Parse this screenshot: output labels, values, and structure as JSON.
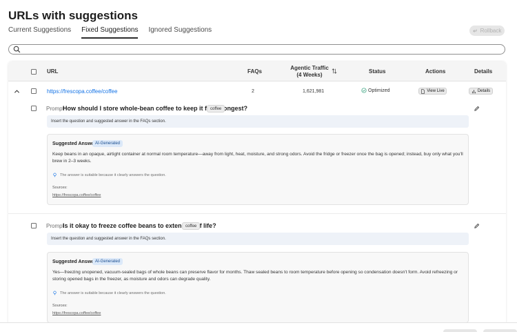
{
  "page": {
    "title": "URLs with suggestions"
  },
  "tabs": [
    {
      "label": "Current Suggestions"
    },
    {
      "label": "Fixed Suggestions"
    },
    {
      "label": "Ignored Suggestions"
    }
  ],
  "active_tab": "Fixed Suggestions",
  "rollback": {
    "label": "Rollback"
  },
  "search": {
    "placeholder": "",
    "value": ""
  },
  "table": {
    "headers": {
      "url": "URL",
      "faqs": "FAQs",
      "traffic": "Agentic Traffic (4 Weeks)",
      "status": "Status",
      "actions": "Actions",
      "details": "Details"
    },
    "rows": [
      {
        "url": "https://frescopa.coffee/coffee",
        "faqs": "2",
        "traffic": "1,621,981",
        "status": "Optimized",
        "view_live_label": "View Live",
        "details_label": "Details",
        "prompts": [
          {
            "prompt_label": "Prompt",
            "question": "How should I store whole-bean coffee to keep it fresh longest?",
            "tag": "coffee",
            "info": "Insert the question and suggested answer in the FAQs section.",
            "answer_title": "Suggested Answer",
            "ai_badge": "AI-Generated",
            "answer": "Keep beans in an opaque, airtight container at normal room temperature—away from light, heat, moisture, and strong odors. Avoid the fridge or freezer once the bag is opened; instead, buy only what you'll brew in 2–3 weeks.",
            "reason": "The answer is suitable because it clearly answers the question.",
            "sources_label": "Sources:",
            "source": "https://frescopa.coffee/coffee"
          },
          {
            "prompt_label": "Prompt",
            "question": "Is it okay to freeze coffee beans to extend shelf life?",
            "tag": "coffee",
            "info": "Insert the question and suggested answer in the FAQs section.",
            "answer_title": "Suggested Answer",
            "ai_badge": "AI-Generated",
            "answer": "Yes—freezing unopened, vacuum-sealed bags of whole beans can preserve flavor for months. Thaw sealed beans to room temperature before opening so condensation doesn't form. Avoid refreezing or storing opened bags in the freezer, as moisture and odors can degrade quality.",
            "reason": "The answer is suitable because it clearly answers the question.",
            "sources_label": "Sources:",
            "source": "https://frescopa.coffee/coffee"
          }
        ]
      }
    ]
  },
  "colors": {
    "link": "#1473e6",
    "status_ok": "#2d9d78",
    "ai_badge_bg": "#dce9f9",
    "info_strip_bg": "#eef2f8"
  },
  "icons": [
    "search-icon",
    "rollback-icon",
    "sort-icon",
    "chevron-up-icon",
    "check-circle-icon",
    "document-icon",
    "chart-icon",
    "edit-icon",
    "lightbulb-icon"
  ]
}
